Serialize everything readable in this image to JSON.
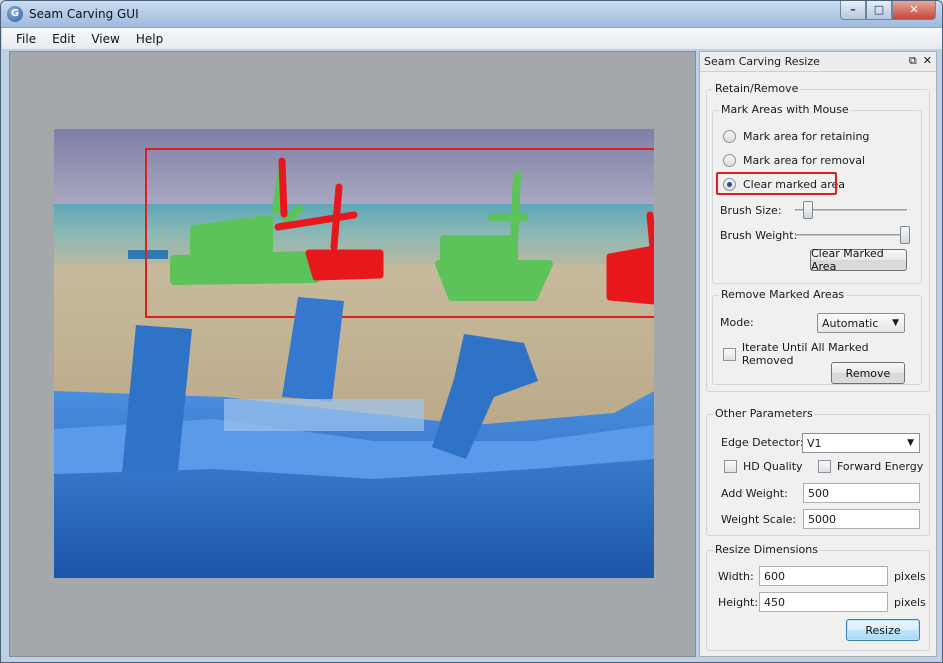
{
  "window": {
    "title": "Seam Carving GUI",
    "app_icon": "G",
    "min": "–",
    "max": "□",
    "close": "✕"
  },
  "menu": [
    "File",
    "Edit",
    "View",
    "Help"
  ],
  "panel": {
    "title": "Seam Carving Resize",
    "float_icon": "⧉",
    "close_icon": "✕",
    "retain_remove": {
      "label": "Retain/Remove",
      "mark_group": "Mark Areas with Mouse",
      "options": [
        "Mark area for retaining",
        "Mark area for removal",
        "Clear marked area"
      ],
      "selected": 2,
      "brush_size_label": "Brush Size:",
      "brush_size_fraction": 0.12,
      "brush_weight_label": "Brush Weight:",
      "brush_weight_fraction": 0.98,
      "clear_button": "Clear Marked Area"
    },
    "remove_marked": {
      "label": "Remove Marked Areas",
      "mode_label": "Mode:",
      "mode_value": "Automatic",
      "iterate_label": "Iterate Until All Marked Removed",
      "iterate_checked": false,
      "remove_button": "Remove"
    },
    "other": {
      "label": "Other Parameters",
      "edge_label": "Edge Detector:",
      "edge_value": "V1",
      "hd_label": "HD Quality",
      "hd_checked": false,
      "forward_label": "Forward Energy",
      "forward_checked": false,
      "add_weight_label": "Add Weight:",
      "add_weight_value": "500",
      "weight_scale_label": "Weight Scale:",
      "weight_scale_value": "5000"
    },
    "resize": {
      "label": "Resize Dimensions",
      "width_label": "Width:",
      "width_value": "600",
      "height_label": "Height:",
      "height_value": "450",
      "unit": "pixels",
      "resize_button": "Resize"
    }
  },
  "colors": {
    "retain_mark": "#5cc25a",
    "remove_mark": "#e8171c",
    "boat_blue": "#2f73c9",
    "highlight": "#e02020"
  }
}
